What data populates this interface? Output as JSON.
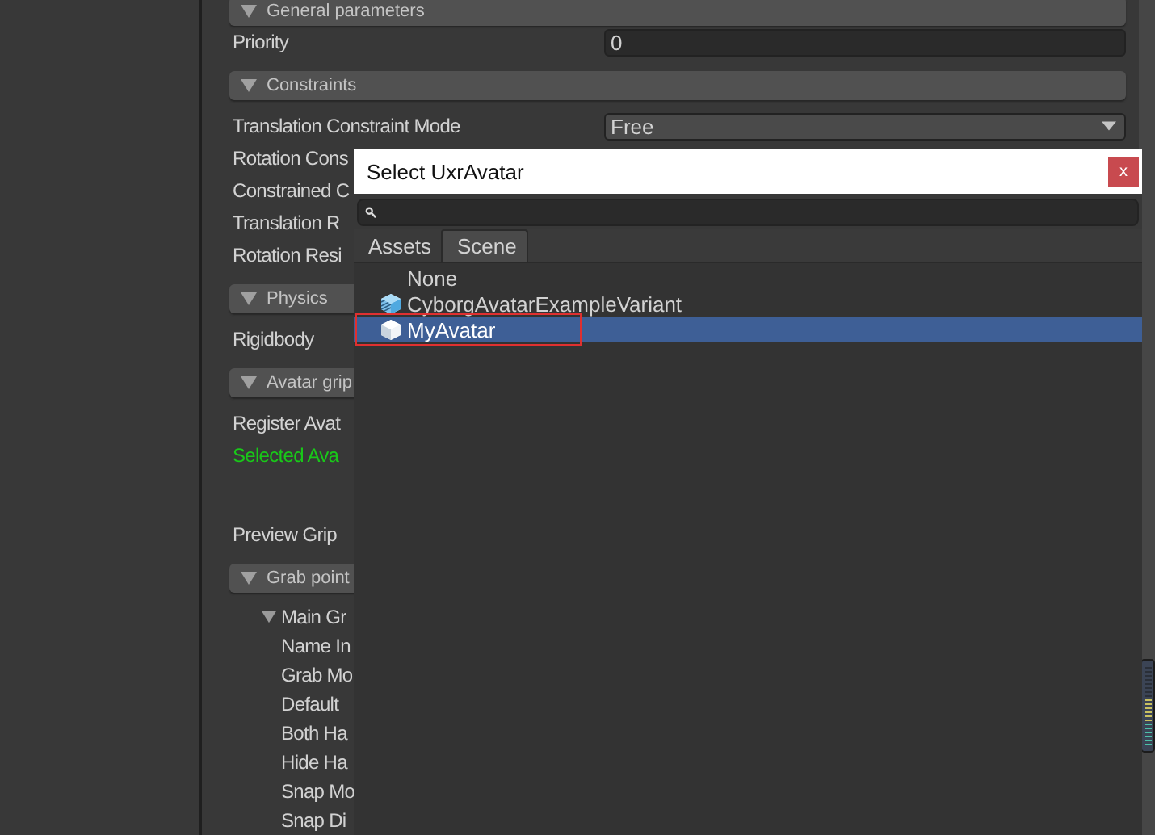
{
  "inspector": {
    "sections": [
      {
        "title": "General parameters",
        "expanded": true,
        "rows": [
          {
            "label": "Priority",
            "kind": "text",
            "value": "0"
          }
        ]
      },
      {
        "title": "Constraints",
        "expanded": true,
        "rows": [
          {
            "label": "Translation Constraint Mode",
            "kind": "dropdown",
            "value": "Free"
          },
          {
            "label": "Rotation Cons",
            "kind": "label"
          },
          {
            "label": "Constrained C",
            "kind": "label"
          },
          {
            "label": "Translation R",
            "kind": "label"
          },
          {
            "label": "Rotation Resi",
            "kind": "label"
          }
        ]
      },
      {
        "title": "Physics",
        "expanded": true,
        "rows": [
          {
            "label": "Rigidbody",
            "kind": "label"
          }
        ]
      },
      {
        "title": "Avatar grip",
        "expanded": true,
        "rows": [
          {
            "label": "Register Avat",
            "kind": "label"
          },
          {
            "label": "Selected Ava",
            "kind": "status"
          },
          {
            "label": "Preview Grip",
            "kind": "spaced"
          }
        ]
      },
      {
        "title": "Grab point",
        "expanded": true,
        "tree": [
          {
            "label": "Main Gr",
            "expanded": true,
            "children": [
              {
                "label": "Name In"
              },
              {
                "label": "Grab Mo"
              },
              {
                "label": "Default"
              },
              {
                "label": "Both Ha"
              },
              {
                "label": "Hide Ha"
              },
              {
                "label": "Snap Mo"
              },
              {
                "label": "Snap Di"
              }
            ]
          }
        ]
      }
    ]
  },
  "dialog": {
    "title": "Select UxrAvatar",
    "close": "x",
    "tabs": [
      {
        "label": "Assets",
        "selected": false
      },
      {
        "label": "Scene",
        "selected": true
      }
    ],
    "items": [
      {
        "label": "None",
        "kind": "none",
        "selected": false,
        "highlighted": false
      },
      {
        "label": "CyborgAvatarExampleVariant",
        "kind": "prefab-variant",
        "selected": false,
        "highlighted": false
      },
      {
        "label": "MyAvatar",
        "kind": "prefab",
        "selected": true,
        "highlighted": true
      }
    ]
  }
}
